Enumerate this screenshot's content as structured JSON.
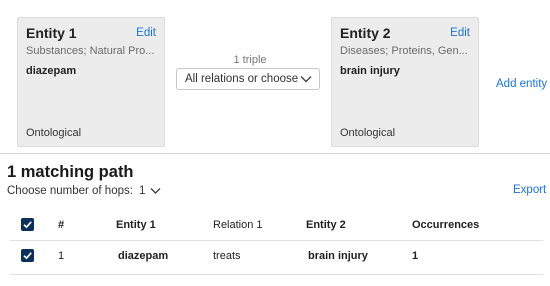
{
  "entity1": {
    "title": "Entity 1",
    "edit_label": "Edit",
    "categories": "Substances; Natural Pro...",
    "name": "diazepam",
    "type": "Ontological"
  },
  "entity2": {
    "title": "Entity 2",
    "edit_label": "Edit",
    "categories": "Diseases; Proteins, Gen...",
    "name": "brain injury",
    "type": "Ontological"
  },
  "relation": {
    "triple_count": "1 triple",
    "selected": "All relations or choose"
  },
  "add_entity_label": "Add entity",
  "results": {
    "title": "1 matching path",
    "hops_label": "Choose number of hops:",
    "hops_value": "1",
    "export_label": "Export"
  },
  "table": {
    "headers": [
      "#",
      "Entity 1",
      "Relation 1",
      "Entity 2",
      "Occurrences"
    ],
    "rows": [
      {
        "num": "1",
        "entity1": "diazepam",
        "relation1": "treats",
        "entity2": "brain injury",
        "occurrences": "1",
        "checked": true
      }
    ]
  },
  "colors": {
    "link": "#1a73d9",
    "card_bg": "#ececec",
    "checkbox": "#0d2f5c"
  },
  "icons": [
    "chevron-down-icon",
    "checkbox-checked-icon"
  ]
}
